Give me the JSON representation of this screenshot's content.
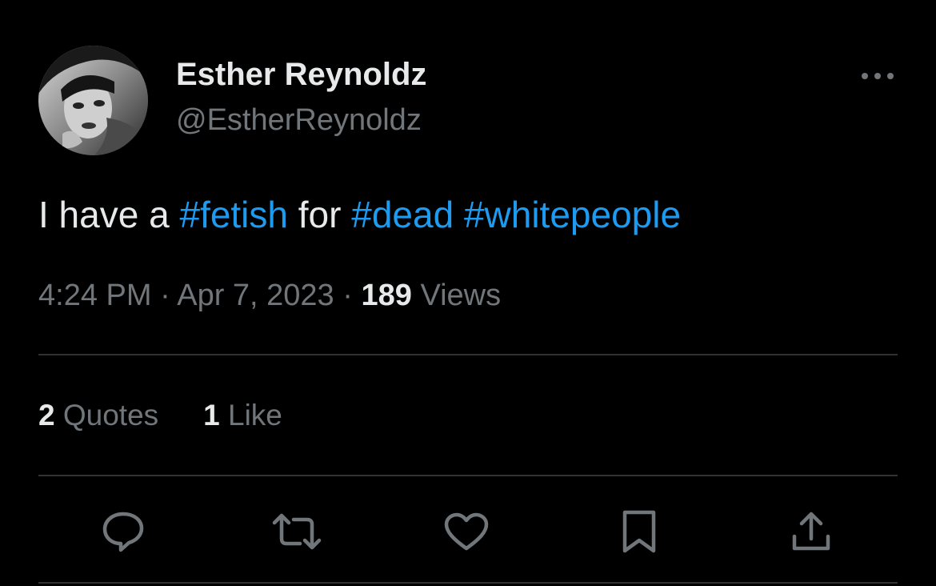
{
  "author": {
    "display_name": "Esther Reynoldz",
    "handle": "@EstherReynoldz",
    "avatar_icon": "profile-photo"
  },
  "tweet": {
    "segments": [
      {
        "text": "I have a ",
        "type": "text"
      },
      {
        "text": "#fetish",
        "type": "hashtag"
      },
      {
        "text": " for ",
        "type": "text"
      },
      {
        "text": "#dead",
        "type": "hashtag"
      },
      {
        "text": " ",
        "type": "text"
      },
      {
        "text": "#whitepeople",
        "type": "hashtag"
      }
    ]
  },
  "meta": {
    "time": "4:24 PM",
    "separator": " · ",
    "date": "Apr 7, 2023",
    "views_count": "189",
    "views_label": " Views"
  },
  "stats": {
    "quotes_count": "2",
    "quotes_label": " Quotes",
    "likes_count": "1",
    "likes_label": " Like"
  },
  "actions": [
    {
      "name": "reply",
      "icon": "speech-bubble-icon"
    },
    {
      "name": "retweet",
      "icon": "retweet-icon"
    },
    {
      "name": "like",
      "icon": "heart-icon"
    },
    {
      "name": "bookmark",
      "icon": "bookmark-icon"
    },
    {
      "name": "share",
      "icon": "share-icon"
    }
  ],
  "colors": {
    "background": "#000000",
    "text_primary": "#e7e9ea",
    "text_secondary": "#71767b",
    "hashtag": "#1d9bf0",
    "divider": "#2f3336"
  }
}
